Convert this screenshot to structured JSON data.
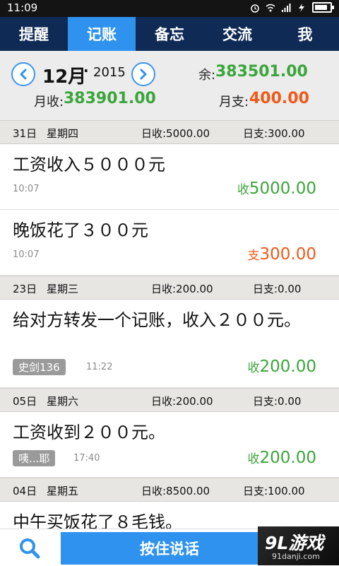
{
  "status": {
    "time": "11:09"
  },
  "tabs": [
    {
      "label": "提醒",
      "active": false
    },
    {
      "label": "记账",
      "active": true
    },
    {
      "label": "备忘",
      "active": false
    },
    {
      "label": "交流",
      "active": false
    },
    {
      "label": "我",
      "active": false
    }
  ],
  "summary": {
    "month": "12月",
    "dot": "·",
    "year": "2015",
    "balance_label": "余:",
    "balance": "383501.00",
    "month_income_label": "月收:",
    "month_income": "383901.00",
    "month_expense_label": "月支:",
    "month_expense": "400.00"
  },
  "days": [
    {
      "date": "31日",
      "weekday": "星期四",
      "income": "日收:5000.00",
      "expense": "日支:300.00",
      "entries": [
        {
          "title": "工资收入５０００元",
          "time": "10:07",
          "kind": "收",
          "amount": "5000.00"
        },
        {
          "title": "晚饭花了３００元",
          "time": "10:07",
          "kind": "支",
          "amount": "300.00"
        }
      ]
    },
    {
      "date": "23日",
      "weekday": "星期三",
      "income": "日收:200.00",
      "expense": "日支:0.00",
      "entries": [
        {
          "title": "给对方转发一个记账，收入２００元。",
          "sender": "史剑136",
          "time": "11:22",
          "kind": "收",
          "amount": "200.00"
        }
      ]
    },
    {
      "date": "05日",
      "weekday": "星期六",
      "income": "日收:200.00",
      "expense": "日支:0.00",
      "entries": [
        {
          "title": "工资收到２００元。",
          "sender": "咦...耶",
          "time": "17:40",
          "kind": "收",
          "amount": "200.00"
        }
      ]
    },
    {
      "date": "04日",
      "weekday": "星期五",
      "income": "日收:8500.00",
      "expense": "日支:100.00",
      "entries": [
        {
          "title": "中午买饭花了８毛钱。"
        }
      ]
    }
  ],
  "bottom": {
    "push_to_talk": "按住说话"
  },
  "watermark": {
    "brand": "9L游戏",
    "url": "91danji.com"
  },
  "colors": {
    "accent": "#2f92ee",
    "navbar": "#0f2a55",
    "income": "#3aa53a",
    "expense": "#ee5a1a"
  }
}
